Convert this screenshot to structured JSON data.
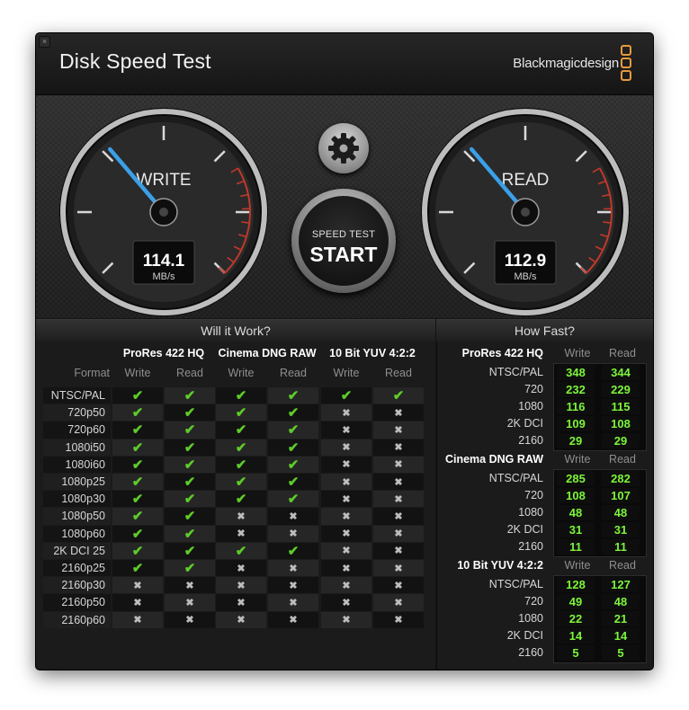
{
  "window": {
    "title": "Disk Speed Test",
    "brand": "Blackmagicdesign",
    "close_glyph": "×"
  },
  "gauges": {
    "write": {
      "label": "WRITE",
      "value": "114.1",
      "unit": "MB/s",
      "needle_fraction": 0.35
    },
    "read": {
      "label": "READ",
      "value": "112.9",
      "unit": "MB/s",
      "needle_fraction": 0.35
    }
  },
  "start_button": {
    "small": "SPEED TEST",
    "big": "START"
  },
  "settings_icon": "gear-icon",
  "will_it_work": {
    "heading": "Will it Work?",
    "format_label": "Format",
    "codecs": [
      "ProRes 422 HQ",
      "Cinema DNG RAW",
      "10 Bit YUV 4:2:2"
    ],
    "subheads": [
      "Write",
      "Read"
    ],
    "rows": [
      {
        "format": "NTSC/PAL",
        "checks": [
          1,
          1,
          1,
          1,
          1,
          1
        ]
      },
      {
        "format": "720p50",
        "checks": [
          1,
          1,
          1,
          1,
          0,
          0
        ]
      },
      {
        "format": "720p60",
        "checks": [
          1,
          1,
          1,
          1,
          0,
          0
        ]
      },
      {
        "format": "1080i50",
        "checks": [
          1,
          1,
          1,
          1,
          0,
          0
        ]
      },
      {
        "format": "1080i60",
        "checks": [
          1,
          1,
          1,
          1,
          0,
          0
        ]
      },
      {
        "format": "1080p25",
        "checks": [
          1,
          1,
          1,
          1,
          0,
          0
        ]
      },
      {
        "format": "1080p30",
        "checks": [
          1,
          1,
          1,
          1,
          0,
          0
        ]
      },
      {
        "format": "1080p50",
        "checks": [
          1,
          1,
          0,
          0,
          0,
          0
        ]
      },
      {
        "format": "1080p60",
        "checks": [
          1,
          1,
          0,
          0,
          0,
          0
        ]
      },
      {
        "format": "2K DCI 25",
        "checks": [
          1,
          1,
          1,
          1,
          0,
          0
        ]
      },
      {
        "format": "2160p25",
        "checks": [
          1,
          1,
          0,
          0,
          0,
          0
        ]
      },
      {
        "format": "2160p30",
        "checks": [
          0,
          0,
          0,
          0,
          0,
          0
        ]
      },
      {
        "format": "2160p50",
        "checks": [
          0,
          0,
          0,
          0,
          0,
          0
        ]
      },
      {
        "format": "2160p60",
        "checks": [
          0,
          0,
          0,
          0,
          0,
          0
        ]
      }
    ]
  },
  "how_fast": {
    "heading": "How Fast?",
    "subheads": [
      "Write",
      "Read"
    ],
    "groups": [
      {
        "codec": "ProRes 422 HQ",
        "rows": [
          {
            "format": "NTSC/PAL",
            "write": "348",
            "read": "344"
          },
          {
            "format": "720",
            "write": "232",
            "read": "229"
          },
          {
            "format": "1080",
            "write": "116",
            "read": "115"
          },
          {
            "format": "2K DCI",
            "write": "109",
            "read": "108"
          },
          {
            "format": "2160",
            "write": "29",
            "read": "29"
          }
        ]
      },
      {
        "codec": "Cinema DNG RAW",
        "rows": [
          {
            "format": "NTSC/PAL",
            "write": "285",
            "read": "282"
          },
          {
            "format": "720",
            "write": "108",
            "read": "107"
          },
          {
            "format": "1080",
            "write": "48",
            "read": "48"
          },
          {
            "format": "2K DCI",
            "write": "31",
            "read": "31"
          },
          {
            "format": "2160",
            "write": "11",
            "read": "11"
          }
        ]
      },
      {
        "codec": "10 Bit YUV 4:2:2",
        "rows": [
          {
            "format": "NTSC/PAL",
            "write": "128",
            "read": "127"
          },
          {
            "format": "720",
            "write": "49",
            "read": "48"
          },
          {
            "format": "1080",
            "write": "22",
            "read": "21"
          },
          {
            "format": "2K DCI",
            "write": "14",
            "read": "14"
          },
          {
            "format": "2160",
            "write": "5",
            "read": "5"
          }
        ]
      }
    ]
  },
  "symbols": {
    "check": "✔",
    "cross": "✖"
  },
  "colors": {
    "accent_blue": "#3aa0e8",
    "ok_green": "#5ecb2a",
    "number_green": "#7cf53a",
    "redline": "#c0392b",
    "brand_orange": "#e89a3c"
  }
}
